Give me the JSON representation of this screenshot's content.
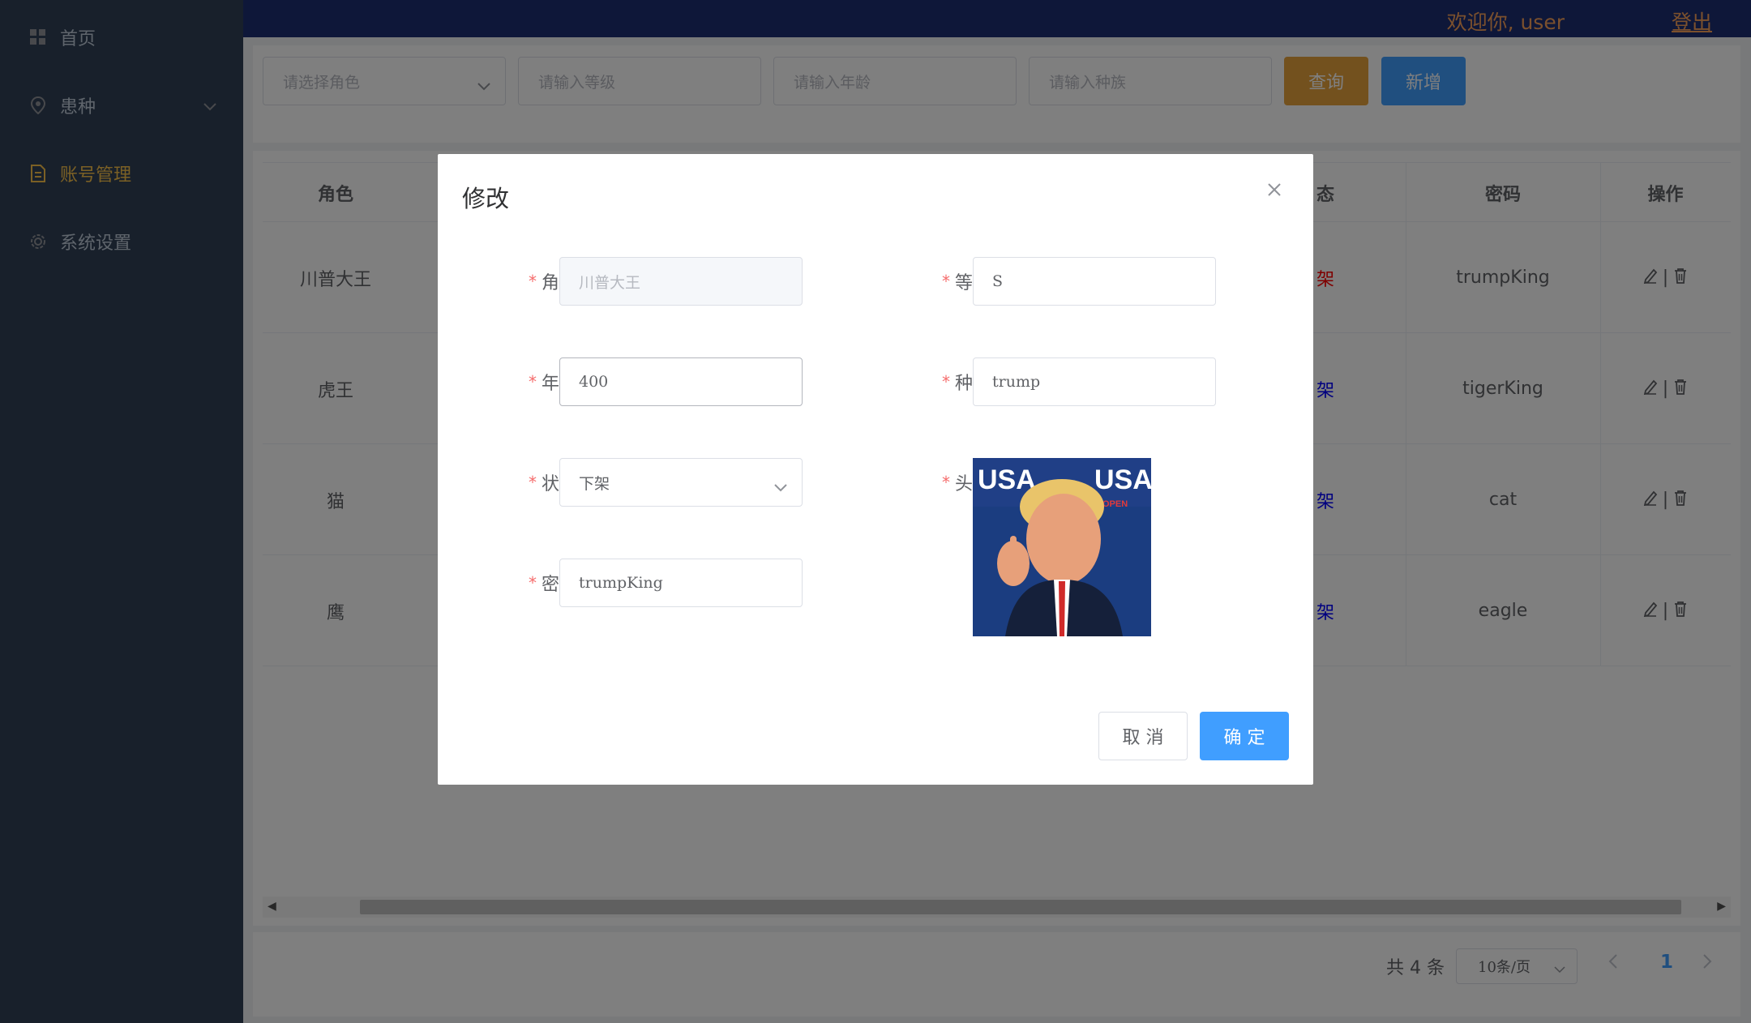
{
  "sidebar": {
    "items": [
      {
        "label": "首页",
        "icon": "grid-icon"
      },
      {
        "label": "患种",
        "icon": "location-pin-icon"
      },
      {
        "label": "账号管理",
        "icon": "document-icon"
      },
      {
        "label": "系统设置",
        "icon": "gear-icon"
      }
    ],
    "colors": {
      "bg": "#304156",
      "active": "#f7c04a"
    }
  },
  "header": {
    "welcome": "欢迎你, user",
    "logout": "登出"
  },
  "search": {
    "role_placeholder": "请选择角色",
    "level_placeholder": "请输入等级",
    "age_placeholder": "请输入年龄",
    "race_placeholder": "请输入种族",
    "query_label": "查询",
    "add_label": "新增"
  },
  "table": {
    "headers": {
      "role": "角色",
      "status": "态",
      "password": "密码",
      "ops": "操作"
    },
    "rows": [
      {
        "role": "川普大王",
        "status": "架",
        "status_color": "#ff0000",
        "password": "trumpKing"
      },
      {
        "role": "虎王",
        "status": "架",
        "status_color": "#0000ff",
        "password": "tigerKing"
      },
      {
        "role": "猫",
        "status": "架",
        "status_color": "#0000ff",
        "password": "cat"
      },
      {
        "role": "鹰",
        "status": "架",
        "status_color": "#0000ff",
        "password": "eagle"
      }
    ],
    "ops_separator": "|"
  },
  "pagination": {
    "total": "共 4 条",
    "page_size": "10条/页",
    "current_page": "1"
  },
  "dialog": {
    "title": "修改",
    "fields": {
      "role": {
        "label": "角色",
        "value": "川普大王"
      },
      "level": {
        "label": "等级",
        "value": "S"
      },
      "age": {
        "label": "年龄",
        "value": "400"
      },
      "race": {
        "label": "种族",
        "value": "trump"
      },
      "status": {
        "label": "状态",
        "value": "下架"
      },
      "avatar": {
        "label": "头像"
      },
      "password": {
        "label": "密码",
        "value": "trumpKing"
      }
    },
    "required_mark": "*",
    "avatar_text": {
      "left": "USA",
      "right": "USA",
      "badge": "OPEN"
    },
    "cancel_label": "取 消",
    "ok_label": "确 定"
  },
  "colors": {
    "primary": "#409eff",
    "warning": "#e6a23c",
    "danger": "#f56c6c",
    "header": "#1c2f73"
  }
}
